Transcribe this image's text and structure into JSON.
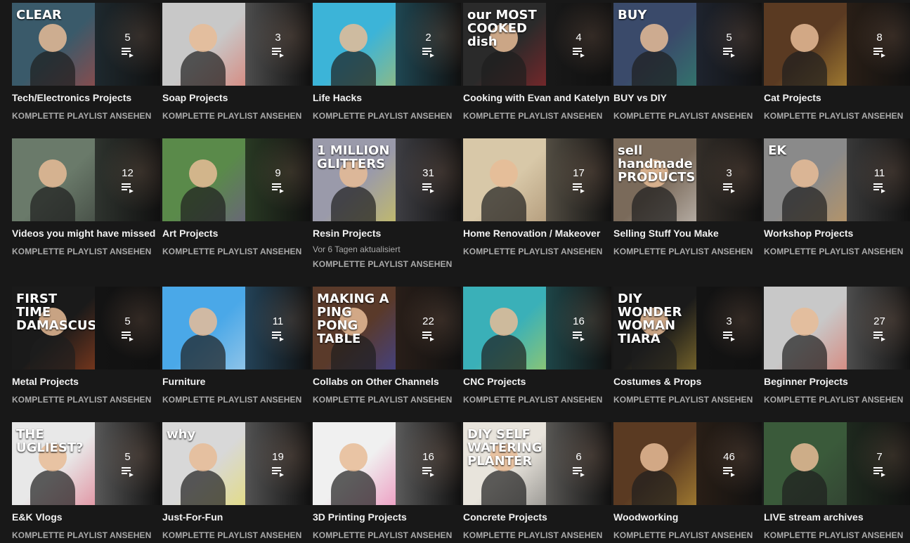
{
  "view_all_label": "KOMPLETTE PLAYLIST ANSEHEN",
  "playlists": [
    {
      "title": "Tech/Electronics Projects",
      "count": "5",
      "thumb_text": "CLEAR",
      "thumb_color": "#3a5a6a",
      "thumb_accent": "#e83b2a"
    },
    {
      "title": "Soap Projects",
      "count": "3",
      "thumb_text": "",
      "thumb_color": "#c8c8c8",
      "thumb_accent": "#e6402b"
    },
    {
      "title": "Life Hacks",
      "count": "2",
      "thumb_text": "",
      "thumb_color": "#3cb4d8",
      "thumb_accent": "#f0c020"
    },
    {
      "title": "Cooking with Evan and Katelyn",
      "count": "4",
      "thumb_text": "our MOST\nCOOKED dish",
      "thumb_color": "#2a2a2a",
      "thumb_accent": "#d4232a"
    },
    {
      "title": "BUY vs DIY",
      "count": "5",
      "thumb_text": "BUY",
      "thumb_color": "#3a4a6a",
      "thumb_accent": "#2aa870"
    },
    {
      "title": "Cat Projects",
      "count": "8",
      "thumb_text": "",
      "thumb_color": "#5a3a22",
      "thumb_accent": "#f5c842"
    },
    {
      "title": "Videos you might have missed",
      "count": "12",
      "thumb_text": "",
      "thumb_color": "#6a7a6a",
      "thumb_accent": "#1e1e1e"
    },
    {
      "title": "Art Projects",
      "count": "9",
      "thumb_text": "",
      "thumb_color": "#5a8a4a",
      "thumb_accent": "#7a3ab0"
    },
    {
      "title": "Resin Projects",
      "count": "31",
      "thumb_text": "1 MILLION GLITTERS",
      "thumb_color": "#9a9aaa",
      "thumb_accent": "#f0e020",
      "updated": "Vor 6 Tagen aktualisiert"
    },
    {
      "title": "Home Renovation / Makeover",
      "count": "17",
      "thumb_text": "",
      "thumb_color": "#d8c8a8",
      "thumb_accent": "#8a6a4a"
    },
    {
      "title": "Selling Stuff You Make",
      "count": "3",
      "thumb_text": "sell handmade\nPRODUCTS",
      "thumb_color": "#7a6a5a",
      "thumb_accent": "#ffffff"
    },
    {
      "title": "Workshop Projects",
      "count": "11",
      "thumb_text": "EK",
      "thumb_color": "#8a8a8a",
      "thumb_accent": "#e8a040"
    },
    {
      "title": "Metal Projects",
      "count": "5",
      "thumb_text": "FIRST TIME\nDAMASCUS",
      "thumb_color": "#1a1a1a",
      "thumb_accent": "#e85a20"
    },
    {
      "title": "Furniture",
      "count": "11",
      "thumb_text": "",
      "thumb_color": "#4aa8e8",
      "thumb_accent": "#e8e8e8"
    },
    {
      "title": "Collabs on Other Channels",
      "count": "22",
      "thumb_text": "MAKING A PING PONG TABLE",
      "thumb_color": "#5a3a2a",
      "thumb_accent": "#2a4ae8"
    },
    {
      "title": "CNC Projects",
      "count": "16",
      "thumb_text": "",
      "thumb_color": "#3ab0b8",
      "thumb_accent": "#f0e020"
    },
    {
      "title": "Costumes & Props",
      "count": "3",
      "thumb_text": "DIY\nWONDER\nWOMAN\nTIARA",
      "thumb_color": "#1a1a1a",
      "thumb_accent": "#e8c040"
    },
    {
      "title": "Beginner Projects",
      "count": "27",
      "thumb_text": "",
      "thumb_color": "#c8c8c8",
      "thumb_accent": "#e6402b"
    },
    {
      "title": "E&K Vlogs",
      "count": "5",
      "thumb_text": "THE\nUGLIEST?",
      "thumb_color": "#e8e8e8",
      "thumb_accent": "#d83050"
    },
    {
      "title": "Just-For-Fun",
      "count": "19",
      "thumb_text": "why",
      "thumb_color": "#d8d8d8",
      "thumb_accent": "#f0e020"
    },
    {
      "title": "3D Printing Projects",
      "count": "16",
      "thumb_text": "",
      "thumb_color": "#f0f0f0",
      "thumb_accent": "#e83a8a"
    },
    {
      "title": "Concrete Projects",
      "count": "6",
      "thumb_text": "DIY SELF\nWATERING\nPLANTER",
      "thumb_color": "#e8e4dc",
      "thumb_accent": "#3a3a3a"
    },
    {
      "title": "Woodworking",
      "count": "46",
      "thumb_text": "",
      "thumb_color": "#5a3a22",
      "thumb_accent": "#f5c842"
    },
    {
      "title": "LIVE stream archives",
      "count": "7",
      "thumb_text": "",
      "thumb_color": "#3a5a3a",
      "thumb_accent": "#2a2a2a"
    }
  ]
}
